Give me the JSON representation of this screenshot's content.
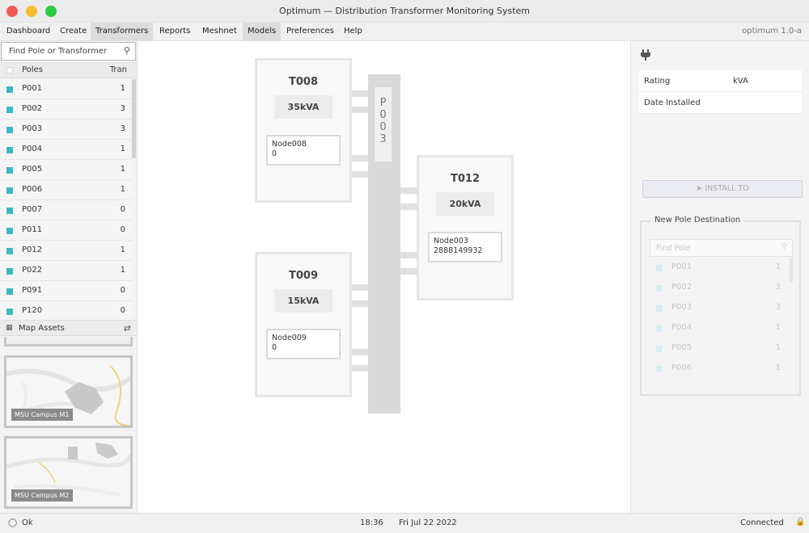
{
  "window": {
    "title": "Optimum — Distribution Transformer Monitoring System"
  },
  "menu": {
    "items": [
      "Dashboard",
      "Create",
      "Transformers",
      "Reports",
      "Meshnet",
      "Models",
      "Preferences",
      "Help"
    ],
    "active": "Transformers",
    "version": "optimum 1.0-a"
  },
  "sidebar": {
    "search_placeholder": "Find Pole or Transformer",
    "col_poles": "Poles",
    "col_tran": "Tran",
    "poles": [
      {
        "name": "P001",
        "count": "1"
      },
      {
        "name": "P002",
        "count": "3"
      },
      {
        "name": "P003",
        "count": "3"
      },
      {
        "name": "P004",
        "count": "1"
      },
      {
        "name": "P005",
        "count": "1"
      },
      {
        "name": "P006",
        "count": "1"
      },
      {
        "name": "P007",
        "count": "0"
      },
      {
        "name": "P011",
        "count": "0"
      },
      {
        "name": "P012",
        "count": "1"
      },
      {
        "name": "P022",
        "count": "1"
      },
      {
        "name": "P091",
        "count": "0"
      },
      {
        "name": "P120",
        "count": "0"
      }
    ],
    "map_assets_label": "Map Assets",
    "maps": [
      {
        "label": "MSU Campus M1"
      },
      {
        "label": "MSU Campus M2"
      }
    ]
  },
  "diagram": {
    "pole": "P003",
    "transformers": [
      {
        "name": "T008",
        "kva": "35kVA",
        "node": "Node008",
        "node_value": "0"
      },
      {
        "name": "T012",
        "kva": "20kVA",
        "node": "Node003",
        "node_value": "2888149932"
      },
      {
        "name": "T009",
        "kva": "15kVA",
        "node": "Node009",
        "node_value": "0"
      }
    ]
  },
  "details": {
    "rating_label": "Rating",
    "rating_value": "kVA",
    "date_label": "Date Installed",
    "date_value": "",
    "install_button": "INSTALL TO",
    "destination_title": "New Pole Destination",
    "destination_search": "Find Pole",
    "destination_poles": [
      {
        "name": "P001",
        "count": "1"
      },
      {
        "name": "P002",
        "count": "3"
      },
      {
        "name": "P003",
        "count": "3"
      },
      {
        "name": "P004",
        "count": "1"
      },
      {
        "name": "P005",
        "count": "1"
      },
      {
        "name": "P006",
        "count": "1"
      }
    ]
  },
  "status": {
    "state": "Ok",
    "time": "18:36",
    "date": "Fri Jul 22 2022",
    "connection": "Connected"
  },
  "colors": {
    "pole_marker": "#3cb8c4"
  }
}
